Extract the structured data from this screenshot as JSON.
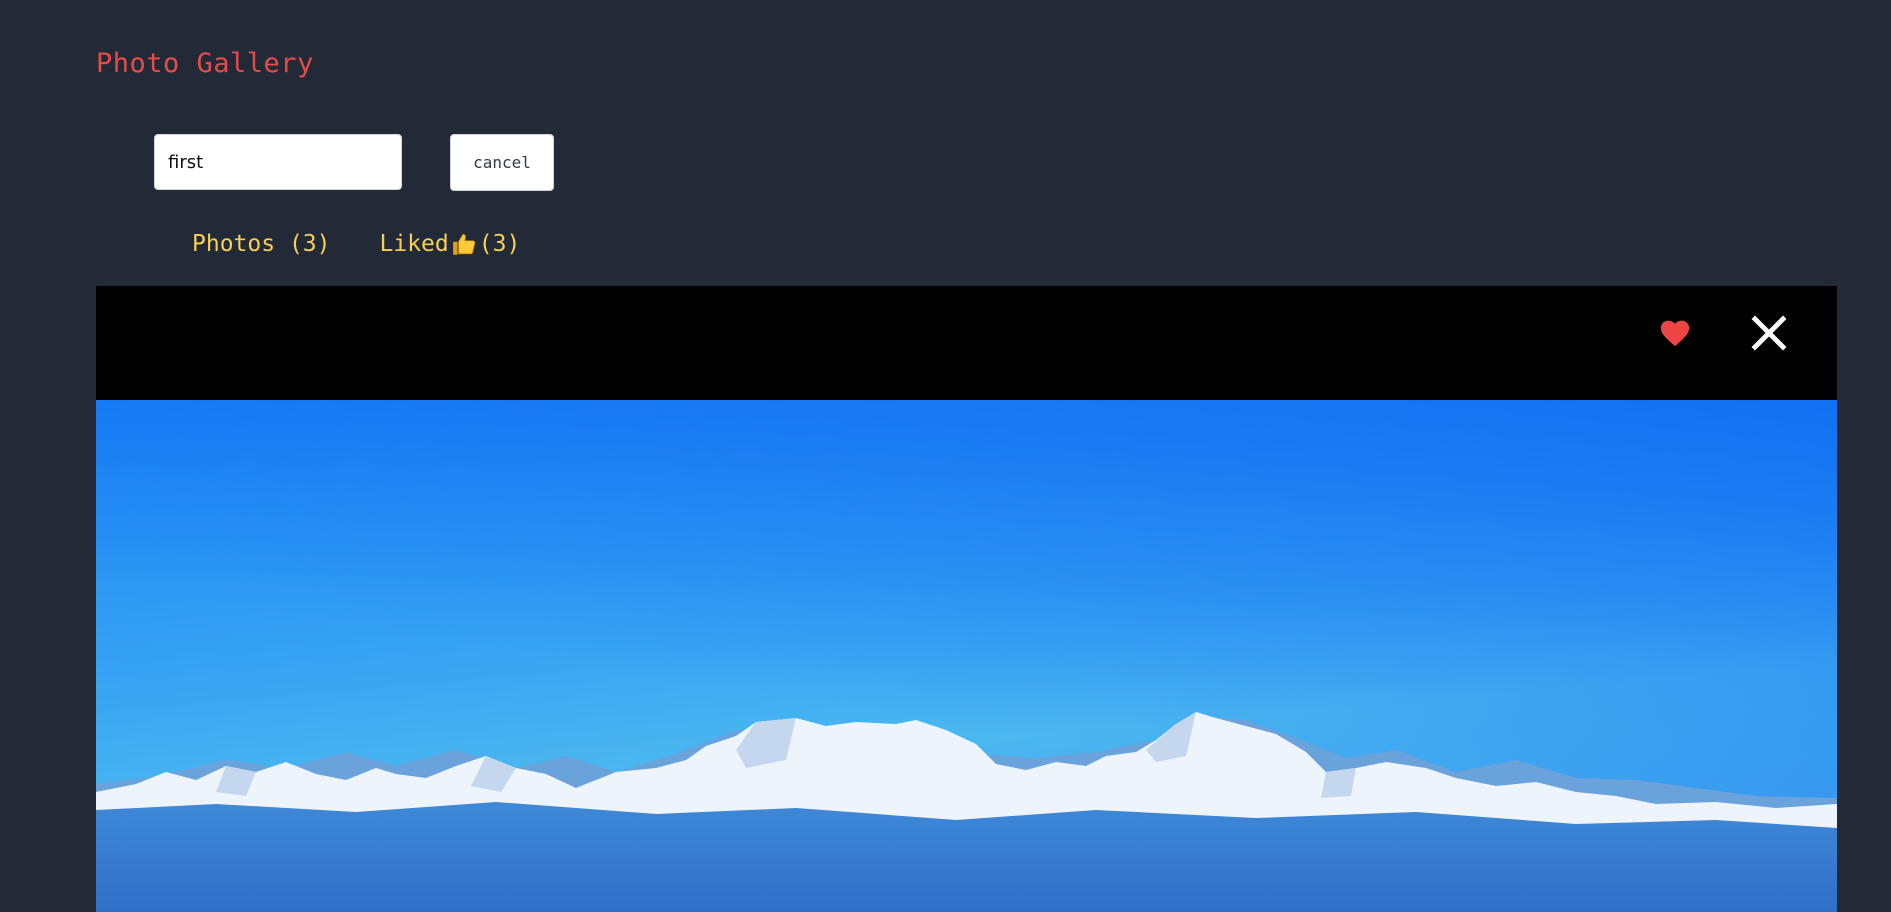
{
  "app": {
    "title": "Photo Gallery"
  },
  "search": {
    "value": "first"
  },
  "cancel_label": "cancel",
  "tabs": [
    {
      "label": "Photos",
      "count": "(3)"
    },
    {
      "label": "Liked",
      "count": "(3)",
      "icon": "thumbs-up-icon"
    }
  ],
  "viewer": {
    "photo_subject": "snow-capped mountain range under blue sky",
    "liked": true,
    "icons": {
      "like": "heart-icon",
      "close": "close-icon"
    },
    "colors": {
      "heart": "#ef4444",
      "sky_top": "#1475f0",
      "sky_mid": "#4bb5f0"
    }
  },
  "colors": {
    "background": "#222a38",
    "title": "#e84a4a",
    "tab": "#f7cf55"
  }
}
